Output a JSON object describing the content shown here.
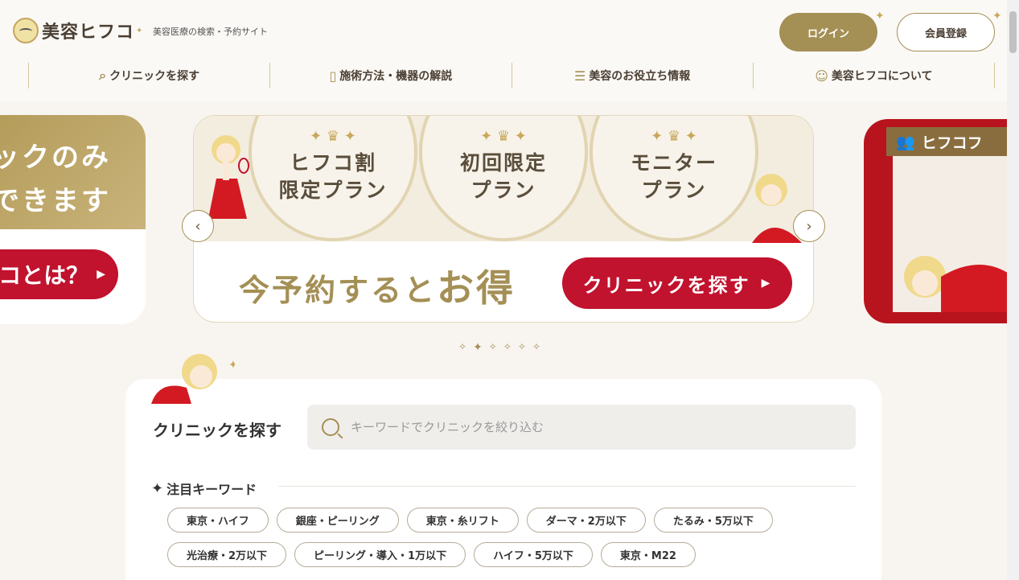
{
  "header": {
    "logo_text": "美容ヒフコ",
    "tagline": "美容医療の検索・予約サイト",
    "login_label": "ログイン",
    "register_label": "会員登録"
  },
  "nav": {
    "items": [
      {
        "label": "クリニックを探す",
        "icon": "clinic-search-icon"
      },
      {
        "label": "施術方法・機器の解説",
        "icon": "book-icon"
      },
      {
        "label": "美容のお役立ち情報",
        "icon": "notebook-icon"
      },
      {
        "label": "美容ヒフコについて",
        "icon": "hifuko-face-icon"
      }
    ]
  },
  "carousel": {
    "left_slide": {
      "line1": "ックのみ",
      "line2": "できます",
      "button_label": "コとは？"
    },
    "main_slide": {
      "medals": [
        "ヒフコ割\n限定プラン",
        "初回限定\nプラン",
        "モニター\nプラン"
      ],
      "promo_prefix": "今予約すると",
      "promo_big": "お得",
      "cta_label": "クリニックを探す"
    },
    "right_slide": {
      "banner": "ヒフコフ"
    },
    "dots": 6,
    "active_dot": 1
  },
  "search_section": {
    "title": "クリニックを探す",
    "placeholder": "キーワードでクリニックを絞り込む",
    "keywords_heading": "注目キーワード",
    "keywords": [
      "東京・ハイフ",
      "銀座・ピーリング",
      "東京・糸リフト",
      "ダーマ・2万以下",
      "たるみ・5万以下",
      "光治療・2万以下",
      "ピーリング・導入・1万以下",
      "ハイフ・5万以下",
      "東京・M22"
    ]
  },
  "colors": {
    "gold": "#a48f55",
    "red": "#c1122e",
    "background": "#f8f5f1"
  }
}
